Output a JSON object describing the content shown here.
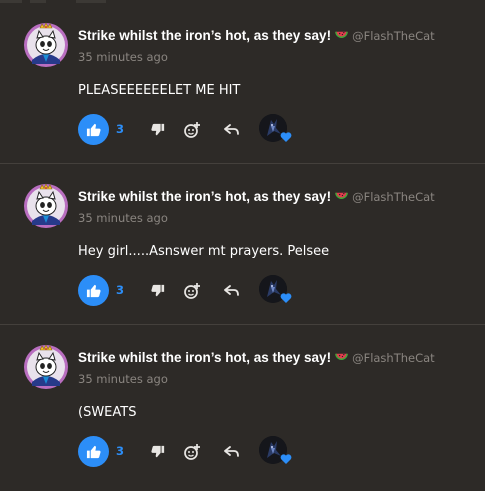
{
  "colors": {
    "background": "#2d2a27",
    "divider": "#44403c",
    "like_blue": "#2c8ef8",
    "muted_text": "#8a8580",
    "heart": "#2c8ef8"
  },
  "comments": [
    {
      "author": {
        "display_name": "Strike whilst the iron’s hot, as they say!",
        "emoji": "watermelon-emoji",
        "handle": "@FlashTheCat",
        "avatar": "cartoon-cat-avatar"
      },
      "timestamp": "35 minutes ago",
      "body": "PLEASEEEEEELET ME HIT",
      "likes": "3",
      "reactor": {
        "avatar": "dark-character-avatar",
        "badge": "heart-icon"
      }
    },
    {
      "author": {
        "display_name": "Strike whilst the iron’s hot, as they say!",
        "emoji": "watermelon-emoji",
        "handle": "@FlashTheCat",
        "avatar": "cartoon-cat-avatar"
      },
      "timestamp": "35 minutes ago",
      "body": "Hey girl.....Asnswer mt prayers. Pelsee",
      "likes": "3",
      "reactor": {
        "avatar": "dark-character-avatar",
        "badge": "heart-icon"
      }
    },
    {
      "author": {
        "display_name": "Strike whilst the iron’s hot, as they say!",
        "emoji": "watermelon-emoji",
        "handle": "@FlashTheCat",
        "avatar": "cartoon-cat-avatar"
      },
      "timestamp": "35 minutes ago",
      "body": "(SWEATS",
      "likes": "3",
      "reactor": {
        "avatar": "dark-character-avatar",
        "badge": "heart-icon"
      }
    }
  ],
  "actions": {
    "like_icon": "thumbs-up-icon",
    "dislike_icon": "thumbs-down-icon",
    "react_icon": "add-reaction-icon",
    "reply_icon": "reply-arrow-icon"
  }
}
